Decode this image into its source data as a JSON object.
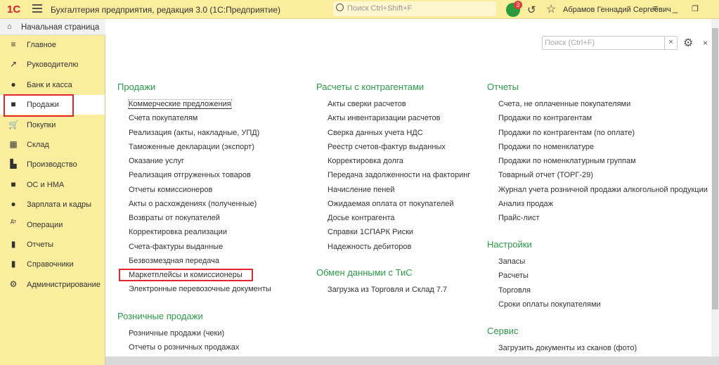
{
  "titlebar": {
    "logo": "1С",
    "title": "Бухгалтерия предприятия, редакция 3.0  (1С:Предприятие)",
    "search_placeholder": "Поиск Ctrl+Shift+F",
    "notifications": "3",
    "user": "Абрамов Геннадий Сергеевич",
    "accent": "#fbed9e"
  },
  "sidebar": {
    "home": "Начальная страница",
    "items": [
      {
        "label": "Главное",
        "icon": "≡"
      },
      {
        "label": "Руководителю",
        "icon": "↗"
      },
      {
        "label": "Банк и касса",
        "icon": "●"
      },
      {
        "label": "Продажи",
        "icon": "■"
      },
      {
        "label": "Покупки",
        "icon": "🛒"
      },
      {
        "label": "Склад",
        "icon": "▦"
      },
      {
        "label": "Производство",
        "icon": "▙"
      },
      {
        "label": "ОС и НМА",
        "icon": "■"
      },
      {
        "label": "Зарплата и кадры",
        "icon": "●"
      },
      {
        "label": "Операции",
        "icon": "Дт"
      },
      {
        "label": "Отчеты",
        "icon": "▮"
      },
      {
        "label": "Справочники",
        "icon": "▮"
      },
      {
        "label": "Администрирование",
        "icon": "⚙"
      }
    ],
    "active": "Продажи"
  },
  "main": {
    "search_placeholder": "Поиск (Ctrl+F)",
    "sections": [
      {
        "title": "Продажи",
        "items": [
          "Коммерческие предложения",
          "Счета покупателям",
          "Реализация (акты, накладные, УПД)",
          "Таможенные декларации (экспорт)",
          "Оказание услуг",
          "Реализация отгруженных товаров",
          "Отчеты комиссионеров",
          "Акты о расхождениях (полученные)",
          "Возвраты от покупателей",
          "Корректировка реализации",
          "Счета-фактуры выданные",
          "Безвозмездная передача",
          "Маркетплейсы и комиссионеры",
          "Электронные перевозочные документы"
        ]
      },
      {
        "title": "Розничные продажи",
        "items": [
          "Розничные продажи (чеки)",
          "Отчеты о розничных продажах"
        ]
      },
      {
        "title": "Расчеты с контрагентами",
        "items": [
          "Акты сверки расчетов",
          "Акты инвентаризации расчетов",
          "Сверка данных учета НДС",
          "Реестр счетов-фактур выданных",
          "Корректировка долга",
          "Передача задолженности на факторинг",
          "Начисление пеней",
          "Ожидаемая оплата от покупателей",
          "Досье контрагента",
          "Справки 1СПАРК Риски",
          "Надежность дебиторов"
        ]
      },
      {
        "title": "Обмен данными с ТиС",
        "items": [
          "Загрузка из Торговля и Склад 7.7"
        ]
      },
      {
        "title": "Отчеты",
        "items": [
          "Счета, не оплаченные покупателями",
          "Продажи по контрагентам",
          "Продажи по контрагентам (по оплате)",
          "Продажи по номенклатуре",
          "Продажи по номенклатурным группам",
          "Товарный отчет (ТОРГ-29)",
          "Журнал учета розничной продажи алкогольной продукции",
          "Анализ продаж",
          "Прайс-лист"
        ]
      },
      {
        "title": "Настройки",
        "items": [
          "Запасы",
          "Расчеты",
          "Торговля",
          "Сроки оплаты покупателями"
        ]
      },
      {
        "title": "Сервис",
        "items": [
          "Загрузить документы из сканов (фото)"
        ]
      }
    ],
    "heading_color": "#2b9b48",
    "highlight_color": "#e3262e"
  }
}
